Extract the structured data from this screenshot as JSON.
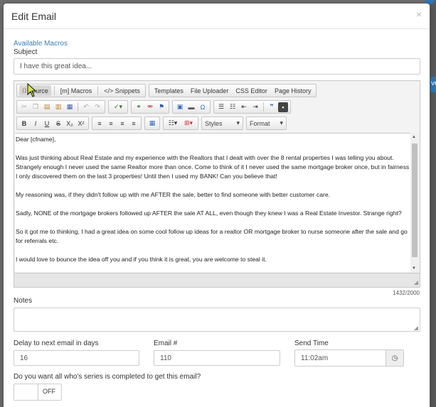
{
  "modal": {
    "title": "Edit Email",
    "close": "×"
  },
  "macros_link": "Available Macros",
  "subject": {
    "label": "Subject",
    "value": "I have this great idea..."
  },
  "toolbar": {
    "source": "Source",
    "macros": "[m] Macros",
    "snippets": "</> Snippets",
    "templates": "Templates",
    "uploader": "File Uploader",
    "css": "CSS Editor",
    "history": "Page History",
    "styles": "Styles",
    "format": "Format"
  },
  "body": {
    "paragraphs": [
      "Dear [cfname],",
      "Was just thinking about Real Estate and my experience with the Realtors that I dealt with over the 8 rental properties I was telling you about. Strangely enough I never used the same Realtor more than once. Come to think of it I never used the same mortgage broker once, but in fairness I only discovered them on the last 3 properties! Until then I used my BANK! Can you believe that!",
      "My reasoning was, if they didn't follow up with me AFTER the sale, better to find someone with better customer care.",
      "Sadly, NONE of the mortgage brokers followed up AFTER the sale AT ALL, even though they knew I was a Real Estate Investor. Strange right?",
      "So it got me to thinking, I had a great idea on some cool follow up ideas for a realtor OR mortgage broker to nurse someone after the sale and go for referrals etc.",
      "I would love to bounce the idea off you and if you think it is great, you are welcome to steal it."
    ],
    "char_count": "1432/2000"
  },
  "notes": {
    "label": "Notes",
    "value": ""
  },
  "delay": {
    "label": "Delay to next email in days",
    "value": "16"
  },
  "email_num": {
    "label": "Email #",
    "value": "110"
  },
  "send_time": {
    "label": "Send Time",
    "value": "11:02am"
  },
  "series_question": {
    "label": "Do you want all who's series is completed to get this email?",
    "toggle_value": "OFF"
  },
  "backdrop_button_text": "ve"
}
